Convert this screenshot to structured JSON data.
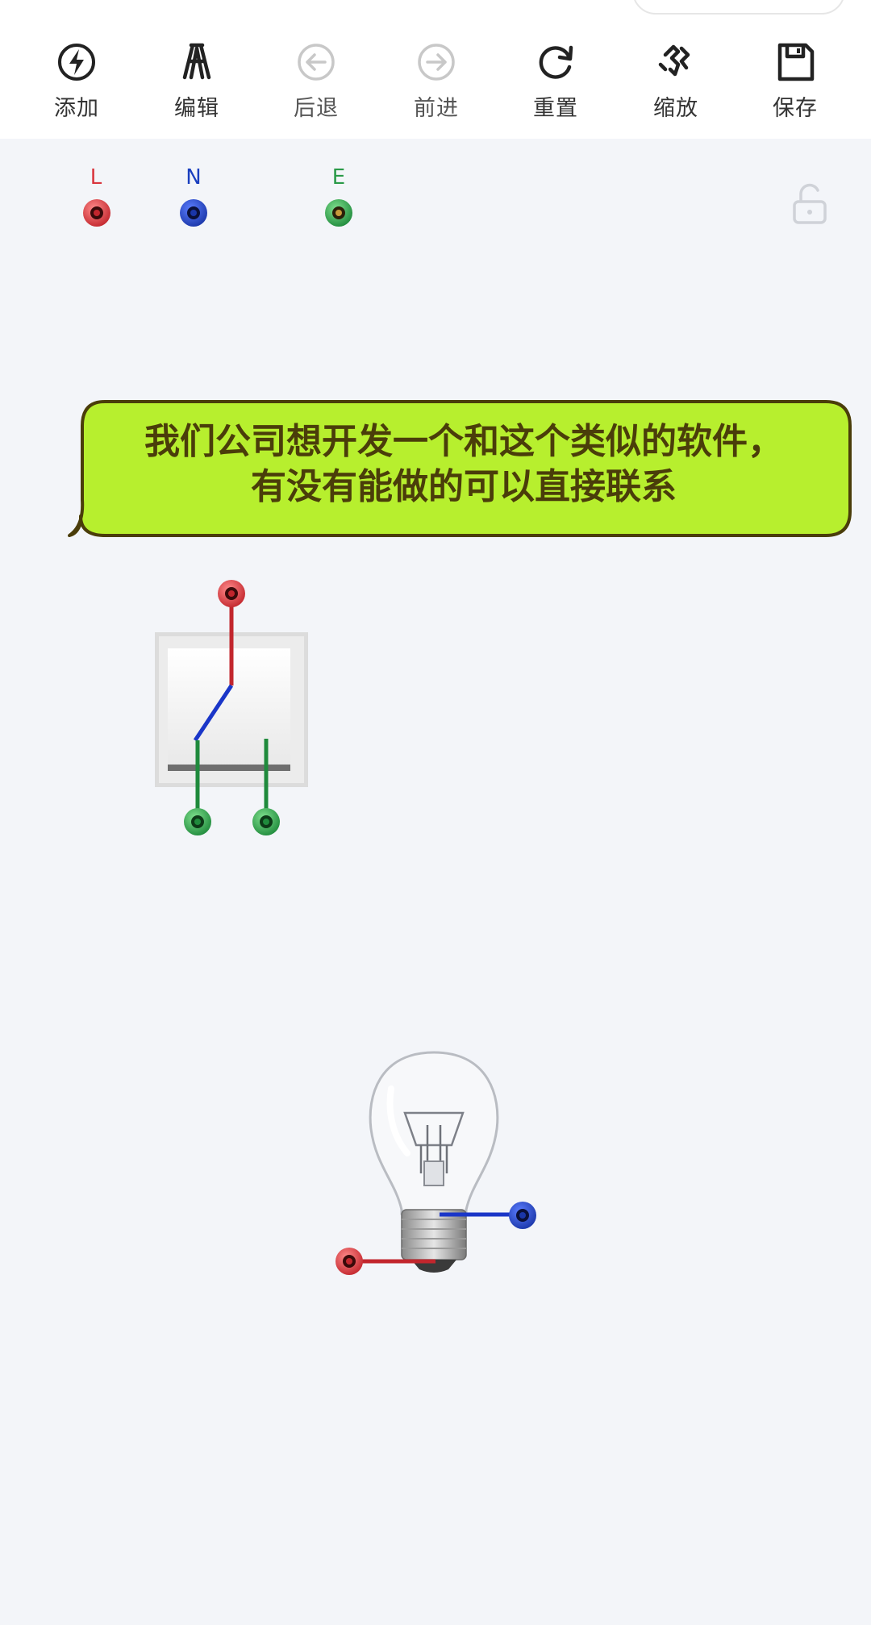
{
  "toolbar": {
    "items": [
      {
        "label": "添加",
        "icon": "lightning-icon",
        "enabled": true
      },
      {
        "label": "编辑",
        "icon": "edit-tool-icon",
        "enabled": true
      },
      {
        "label": "后退",
        "icon": "back-arrow-icon",
        "enabled": false
      },
      {
        "label": "前进",
        "icon": "forward-arrow-icon",
        "enabled": false
      },
      {
        "label": "重置",
        "icon": "reset-icon",
        "enabled": true
      },
      {
        "label": "缩放",
        "icon": "zoom-icon",
        "enabled": true
      },
      {
        "label": "保存",
        "icon": "save-icon",
        "enabled": true
      }
    ]
  },
  "terminals": {
    "L": {
      "label": "L",
      "color": "#d9363e"
    },
    "N": {
      "label": "N",
      "color": "#1a3fbf"
    },
    "E": {
      "label": "E",
      "color": "#2a9a48"
    }
  },
  "lock": {
    "icon": "unlock-icon",
    "state": "unlocked"
  },
  "caption": {
    "line1": "我们公司想开发一个和这个类似的软件，",
    "line2": "有没有能做的可以直接联系",
    "bg_color": "#b7ef2e",
    "border_color": "#4a3d0a"
  },
  "components": {
    "switch": {
      "name": "switch",
      "state": "closed"
    },
    "bulb": {
      "name": "light-bulb",
      "state": "off"
    }
  },
  "colors": {
    "live": "#d9363e",
    "neutral": "#1a3fbf",
    "earth": "#2a9a48"
  }
}
